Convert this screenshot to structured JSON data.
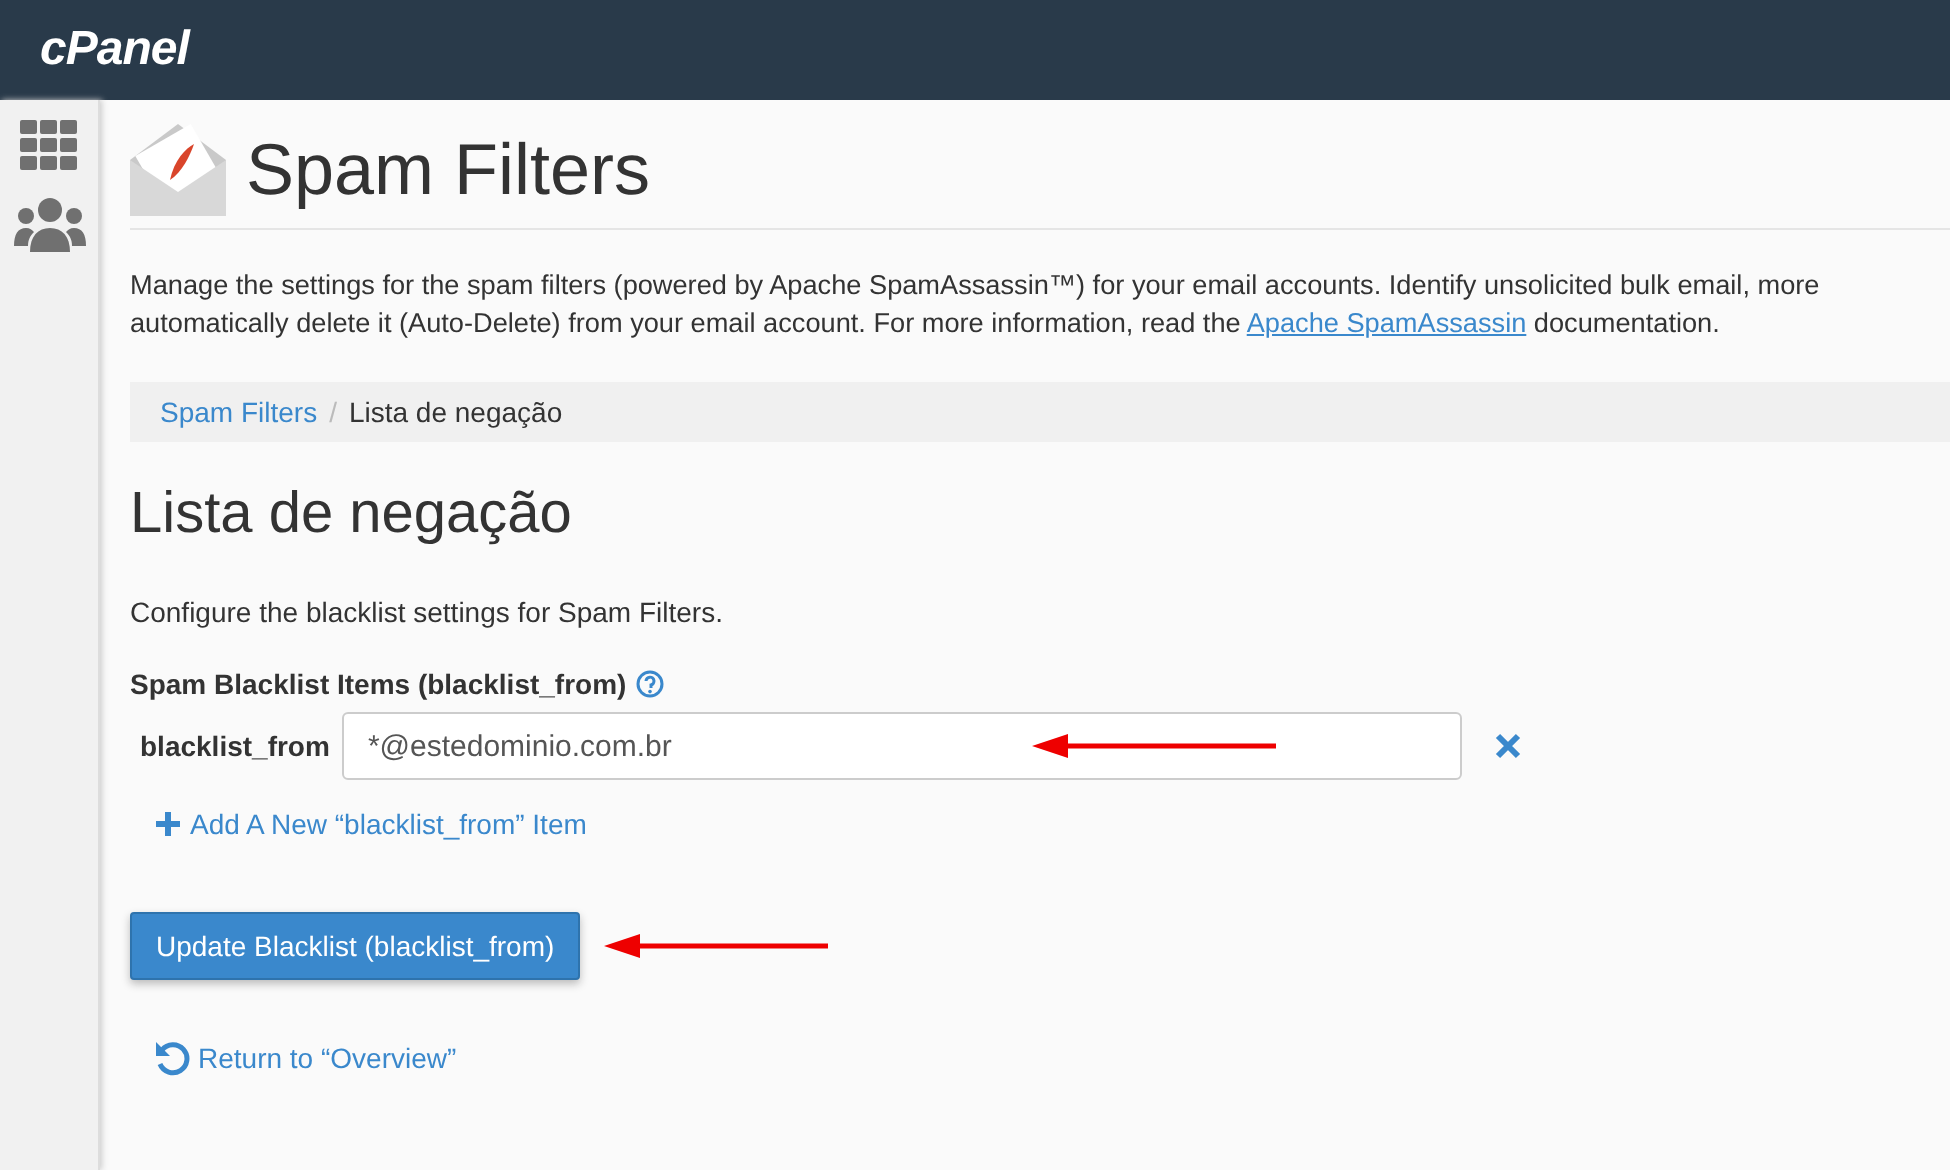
{
  "header": {
    "logo": "cPanel"
  },
  "page": {
    "title": "Spam Filters",
    "description": {
      "lines": [
        "Manage the settings for the spam filters (powered by Apache SpamAssassin™) for your email accounts. Identify unsolicited bulk email, more",
        "automatically delete it (Auto-Delete) from your email account. For more information, read the "
      ],
      "link": "Apache SpamAssassin",
      "after": " documentation."
    }
  },
  "breadcrumb_separator": "/",
  "breadcrumb": [
    {
      "label": "Spam Filters",
      "link": true
    },
    {
      "label": "Lista de negação",
      "link": false
    }
  ],
  "section": {
    "title": "Lista de negação",
    "intro": "Configure the blacklist settings for Spam Filters.",
    "field_group_label": "Spam Blacklist Items (blacklist_from)",
    "items": [
      {
        "label": "blacklist_from",
        "value": "*@estedominio.com.br",
        "annotated": true
      }
    ],
    "add_link": "Add A New “blacklist_from” Item",
    "submit": {
      "label": "Update Blacklist (blacklist_from)",
      "annotated": true
    },
    "return_link": "Return to “Overview”"
  }
}
